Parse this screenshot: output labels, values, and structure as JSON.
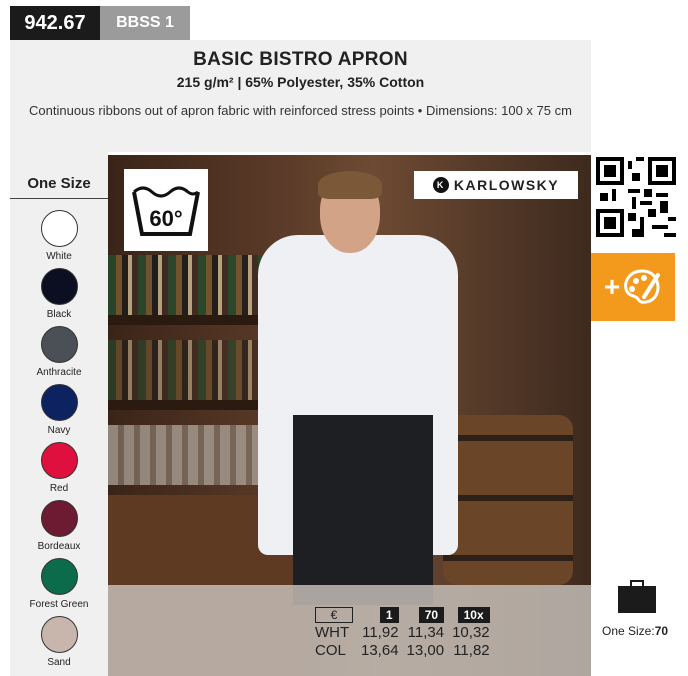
{
  "header": {
    "code": "942.67",
    "sku": "BBSS 1",
    "title": "BASIC BISTRO APRON",
    "subtitle": "215 g/m² | 65% Polyester, 35% Cotton",
    "description": "Continuous ribbons out of apron fabric with reinforced stress points  • Dimensions: 100 x 75 cm"
  },
  "sizes": {
    "label": "One Size"
  },
  "colors": [
    {
      "name": "White",
      "hex": "#ffffff"
    },
    {
      "name": "Black",
      "hex": "#0c0f22"
    },
    {
      "name": "Anthracite",
      "hex": "#4a5056"
    },
    {
      "name": "Navy",
      "hex": "#0d2261"
    },
    {
      "name": "Red",
      "hex": "#e0103e"
    },
    {
      "name": "Bordeaux",
      "hex": "#6d1b33"
    },
    {
      "name": "Forest Green",
      "hex": "#0b6b4a"
    },
    {
      "name": "Sand",
      "hex": "#c8b6ac"
    }
  ],
  "care": {
    "wash_temp": "60°"
  },
  "brand": {
    "name": "KARLOWSKY",
    "mark": "K"
  },
  "pricing": {
    "currency": "€",
    "tiers": [
      "1",
      "70",
      "10x"
    ],
    "rows": [
      {
        "label": "WHT",
        "values": [
          "11,92",
          "11,34",
          "10,32"
        ]
      },
      {
        "label": "COL",
        "values": [
          "13,64",
          "13,00",
          "11,82"
        ]
      }
    ]
  },
  "pack": {
    "label": "One Size:",
    "qty": "70"
  },
  "customize": {
    "label": "+"
  }
}
